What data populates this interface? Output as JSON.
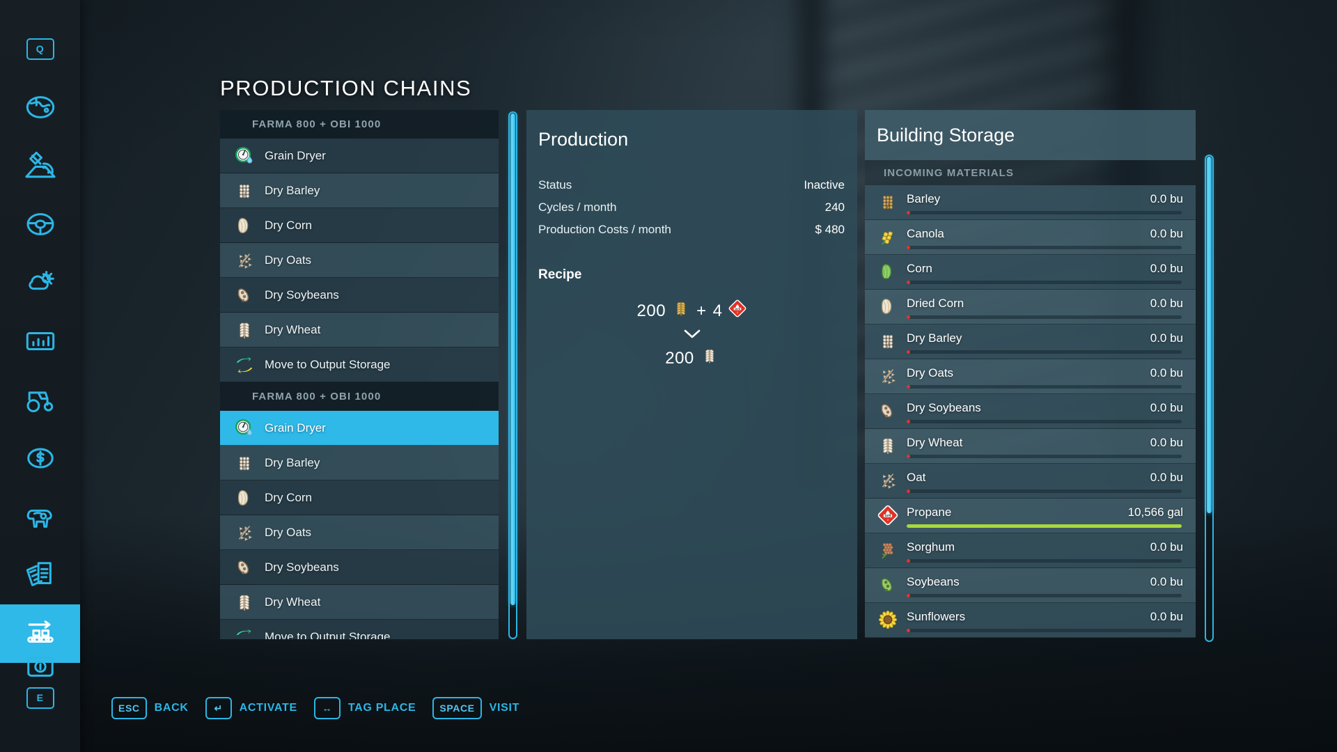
{
  "page": {
    "title": "PRODUCTION CHAINS"
  },
  "sidebar": {
    "accent": "#2cb6e6",
    "items": [
      {
        "name": "quick-menu-key",
        "label": "Q",
        "icon": "key-q",
        "active": false
      },
      {
        "name": "map",
        "label": "Map",
        "icon": "globe-icon",
        "active": false
      },
      {
        "name": "gps",
        "label": "GPS",
        "icon": "satellite-icon",
        "active": false
      },
      {
        "name": "vehicles-steering",
        "label": "Vehicles",
        "icon": "steering-wheel-icon",
        "active": false
      },
      {
        "name": "weather",
        "label": "Weather",
        "icon": "weather-icon",
        "active": false
      },
      {
        "name": "statistics",
        "label": "Statistics",
        "icon": "bar-chart-icon",
        "active": false
      },
      {
        "name": "fleet",
        "label": "Fleet",
        "icon": "tractor-icon",
        "active": false
      },
      {
        "name": "finances",
        "label": "Finances",
        "icon": "dollar-coin-icon",
        "active": false
      },
      {
        "name": "animals",
        "label": "Animals",
        "icon": "cow-icon",
        "active": false
      },
      {
        "name": "contracts",
        "label": "Contracts",
        "icon": "documents-icon",
        "active": false
      },
      {
        "name": "production-chains",
        "label": "Production Chains",
        "icon": "conveyor-icon",
        "active": true
      },
      {
        "name": "radio",
        "label": "Radio",
        "icon": "radio-icon",
        "active": false
      },
      {
        "name": "exit-key",
        "label": "E",
        "icon": "key-e",
        "active": false
      }
    ]
  },
  "list": {
    "groups": [
      {
        "header": "FARMA 800 + OBI 1000",
        "rows": [
          {
            "label": "Grain Dryer",
            "icon": "grain-dryer-icon",
            "selected": false
          },
          {
            "label": "Dry Barley",
            "icon": "dry-barley-icon",
            "selected": false
          },
          {
            "label": "Dry Corn",
            "icon": "dry-corn-icon",
            "selected": false
          },
          {
            "label": "Dry Oats",
            "icon": "dry-oats-icon",
            "selected": false
          },
          {
            "label": "Dry Soybeans",
            "icon": "dry-soybeans-icon",
            "selected": false
          },
          {
            "label": "Dry Wheat",
            "icon": "dry-wheat-icon",
            "selected": false
          },
          {
            "label": "Move to Output Storage",
            "icon": "move-storage-icon",
            "selected": false
          }
        ]
      },
      {
        "header": "FARMA 800 + OBI 1000",
        "rows": [
          {
            "label": "Grain Dryer",
            "icon": "grain-dryer-icon",
            "selected": true
          },
          {
            "label": "Dry Barley",
            "icon": "dry-barley-icon",
            "selected": false
          },
          {
            "label": "Dry Corn",
            "icon": "dry-corn-icon",
            "selected": false
          },
          {
            "label": "Dry Oats",
            "icon": "dry-oats-icon",
            "selected": false
          },
          {
            "label": "Dry Soybeans",
            "icon": "dry-soybeans-icon",
            "selected": false
          },
          {
            "label": "Dry Wheat",
            "icon": "dry-wheat-icon",
            "selected": false
          },
          {
            "label": "Move to Output Storage",
            "icon": "move-storage-icon",
            "selected": false
          }
        ]
      }
    ]
  },
  "production": {
    "title": "Production",
    "stats": [
      {
        "label": "Status",
        "value": "Inactive"
      },
      {
        "label": "Cycles / month",
        "value": "240"
      },
      {
        "label": "Production Costs / month",
        "value": "$ 480"
      }
    ],
    "recipe_heading": "Recipe",
    "recipe": {
      "inputs": [
        {
          "amount": "200",
          "icon": "wheat-icon"
        },
        {
          "plus": "+",
          "amount": "4",
          "icon": "propane-icon"
        }
      ],
      "arrow": "chevron-down-icon",
      "outputs": [
        {
          "amount": "200",
          "icon": "dry-wheat-icon"
        }
      ]
    }
  },
  "storage": {
    "title": "Building Storage",
    "section_label": "INCOMING MATERIALS",
    "bar_colors": {
      "empty": "#e8332a",
      "full": "#a8d93c"
    },
    "rows": [
      {
        "name": "Barley",
        "icon": "barley-icon",
        "amount": "0.0 bu",
        "fill_pct": 0
      },
      {
        "name": "Canola",
        "icon": "canola-icon",
        "amount": "0.0 bu",
        "fill_pct": 0
      },
      {
        "name": "Corn",
        "icon": "corn-icon",
        "amount": "0.0 bu",
        "fill_pct": 0
      },
      {
        "name": "Dried Corn",
        "icon": "dried-corn-icon",
        "amount": "0.0 bu",
        "fill_pct": 0
      },
      {
        "name": "Dry Barley",
        "icon": "dry-barley-icon",
        "amount": "0.0 bu",
        "fill_pct": 0
      },
      {
        "name": "Dry Oats",
        "icon": "dry-oats-icon",
        "amount": "0.0 bu",
        "fill_pct": 0
      },
      {
        "name": "Dry Soybeans",
        "icon": "dry-soybeans-icon",
        "amount": "0.0 bu",
        "fill_pct": 0
      },
      {
        "name": "Dry Wheat",
        "icon": "dry-wheat-icon",
        "amount": "0.0 bu",
        "fill_pct": 0
      },
      {
        "name": "Oat",
        "icon": "oat-icon",
        "amount": "0.0 bu",
        "fill_pct": 0
      },
      {
        "name": "Propane",
        "icon": "propane-icon",
        "amount": "10,566 gal",
        "fill_pct": 100
      },
      {
        "name": "Sorghum",
        "icon": "sorghum-icon",
        "amount": "0.0 bu",
        "fill_pct": 0
      },
      {
        "name": "Soybeans",
        "icon": "soybeans-icon",
        "amount": "0.0 bu",
        "fill_pct": 0
      },
      {
        "name": "Sunflowers",
        "icon": "sunflowers-icon",
        "amount": "0.0 bu",
        "fill_pct": 0
      }
    ]
  },
  "helpbar": [
    {
      "key": "ESC",
      "action": "BACK",
      "icon": "esc-key"
    },
    {
      "key": "↵",
      "action": "ACTIVATE",
      "icon": "enter-key"
    },
    {
      "key": "↔",
      "action": "TAG PLACE",
      "icon": "left-right-arrow-key"
    },
    {
      "key": "SPACE",
      "action": "VISIT",
      "icon": "space-key"
    }
  ]
}
